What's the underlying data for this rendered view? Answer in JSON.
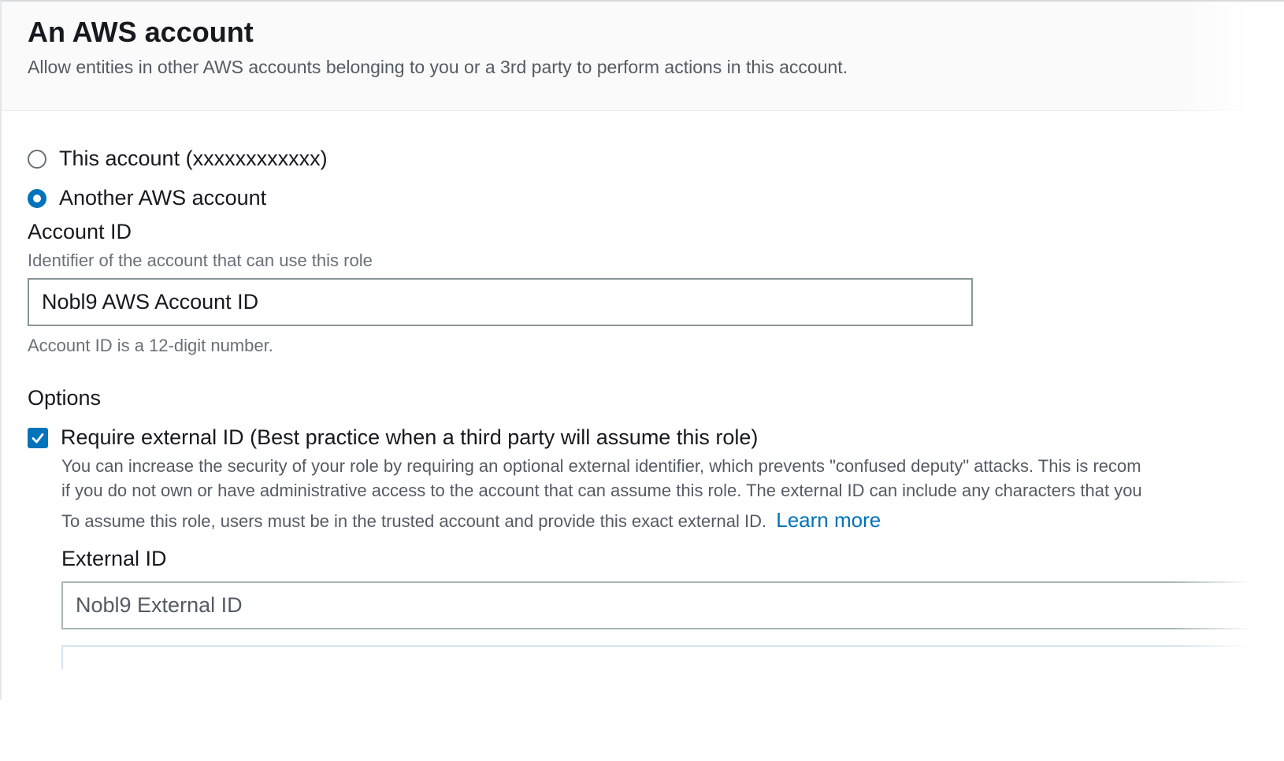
{
  "header": {
    "title": "An AWS account",
    "subtitle": "Allow entities in other AWS accounts belonging to you or a 3rd party to perform actions in this account."
  },
  "account_choice": {
    "options": [
      {
        "label": "This account (xxxxxxxxxxxx)",
        "checked": false
      },
      {
        "label": "Another AWS account",
        "checked": true
      }
    ]
  },
  "account_id": {
    "label": "Account ID",
    "description": "Identifier of the account that can use this role",
    "value": "Nobl9 AWS Account ID",
    "hint": "Account ID is a 12-digit number."
  },
  "options": {
    "label": "Options",
    "require_external_id": {
      "label": "Require external ID (Best practice when a third party will assume this role)",
      "checked": true,
      "description_line1": "You can increase the security of your role by requiring an optional external identifier, which prevents \"confused deputy\" attacks. This is recom",
      "description_line2": "if you do not own or have administrative access to the account that can assume this role. The external ID can include any characters that you",
      "description_line3": "To assume this role, users must be in the trusted account and provide this exact external ID.",
      "learn_more": "Learn more"
    },
    "external_id": {
      "label": "External ID",
      "value": "Nobl9 External ID"
    }
  },
  "colors": {
    "accent": "#0073bb",
    "text": "#16191f",
    "muted": "#687078"
  }
}
